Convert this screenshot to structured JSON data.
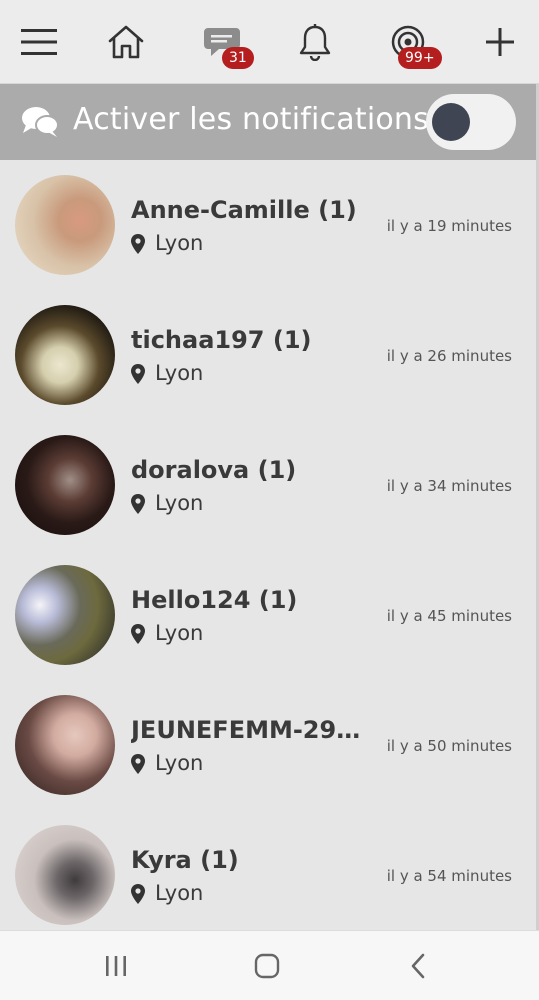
{
  "topbar": {
    "icons": [
      "menu-icon",
      "home-icon",
      "messages-icon",
      "bell-icon",
      "visits-icon",
      "plus-icon"
    ],
    "messages_badge": "31",
    "visits_badge": "99+",
    "badge_color": "#b51e1e"
  },
  "notifications": {
    "label": "Activer les notifications",
    "toggle_on": false
  },
  "list": {
    "items": [
      {
        "name": "Anne-Camille (1)",
        "location": "Lyon",
        "time": "il y a 19 minutes"
      },
      {
        "name": "tichaa197 (1)",
        "location": "Lyon",
        "time": "il y a 26 minutes"
      },
      {
        "name": "doralova (1)",
        "location": "Lyon",
        "time": "il y a 34 minutes"
      },
      {
        "name": "Hello124 (1)",
        "location": "Lyon",
        "time": "il y a 45 minutes"
      },
      {
        "name": "JEUNEFEMM-295...",
        "location": "Lyon",
        "time": "il y a 50 minutes"
      },
      {
        "name": "Kyra (1)",
        "location": "Lyon",
        "time": "il y a 54 minutes"
      }
    ]
  },
  "navbar": {
    "icons": [
      "recent-apps-icon",
      "home-button-icon",
      "back-icon"
    ]
  }
}
